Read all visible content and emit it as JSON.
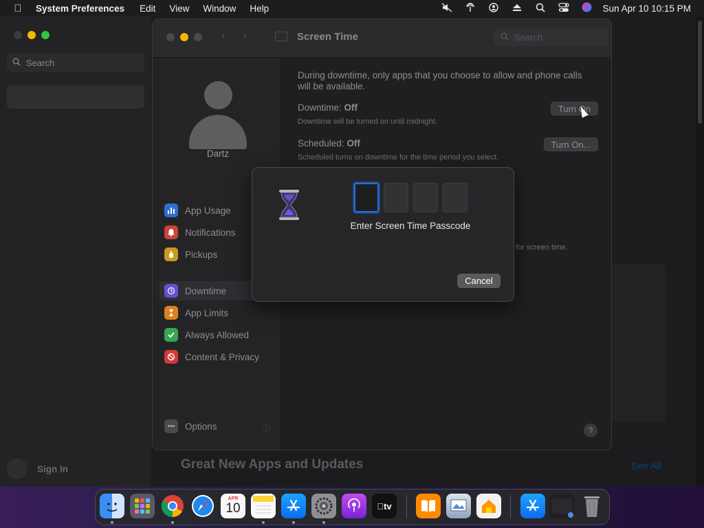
{
  "menubar": {
    "app_name": "System Preferences",
    "menus": [
      "Edit",
      "View",
      "Window",
      "Help"
    ],
    "clock": "Sun Apr 10  10:15 PM"
  },
  "background": {
    "search_placeholder": "Search",
    "sign_in": "Sign In",
    "heading": "Great New Apps and Updates",
    "see_all": "See All"
  },
  "prefs": {
    "title": "Screen Time",
    "search_placeholder": "Search",
    "user_name": "Dartz",
    "sidebar_group1": [
      {
        "label": "App Usage",
        "color": "#2f6fd0",
        "icon": "bar-chart-icon"
      },
      {
        "label": "Notifications",
        "color": "#d04a3a",
        "icon": "bell-icon"
      },
      {
        "label": "Pickups",
        "color": "#d4a020",
        "icon": "hand-icon"
      }
    ],
    "sidebar_group2": [
      {
        "label": "Downtime",
        "color": "#6a4fd0",
        "icon": "moon-clock-icon"
      },
      {
        "label": "App Limits",
        "color": "#e08a20",
        "icon": "hourglass-icon"
      },
      {
        "label": "Always Allowed",
        "color": "#34a853",
        "icon": "checkmark-icon"
      },
      {
        "label": "Content & Privacy",
        "color": "#d63a3a",
        "icon": "no-entry-icon"
      }
    ],
    "options_label": "Options",
    "description": "During downtime, only apps that you choose to allow and phone calls will be available.",
    "downtime_label": "Downtime:",
    "downtime_value": "Off",
    "downtime_sub": "Downtime will be turned on until midnight.",
    "downtime_button": "Turn On",
    "scheduled_label": "Scheduled:",
    "scheduled_value": "Off",
    "scheduled_sub": "Scheduled turns on downtime for the time period you select.",
    "scheduled_button": "Turn On...",
    "note": "for screen time."
  },
  "sheet": {
    "prompt": "Enter Screen Time Passcode",
    "cancel": "Cancel",
    "digits": 4
  },
  "dock": {
    "calendar_month": "APR",
    "calendar_day": "10",
    "tv_label": "tv"
  }
}
